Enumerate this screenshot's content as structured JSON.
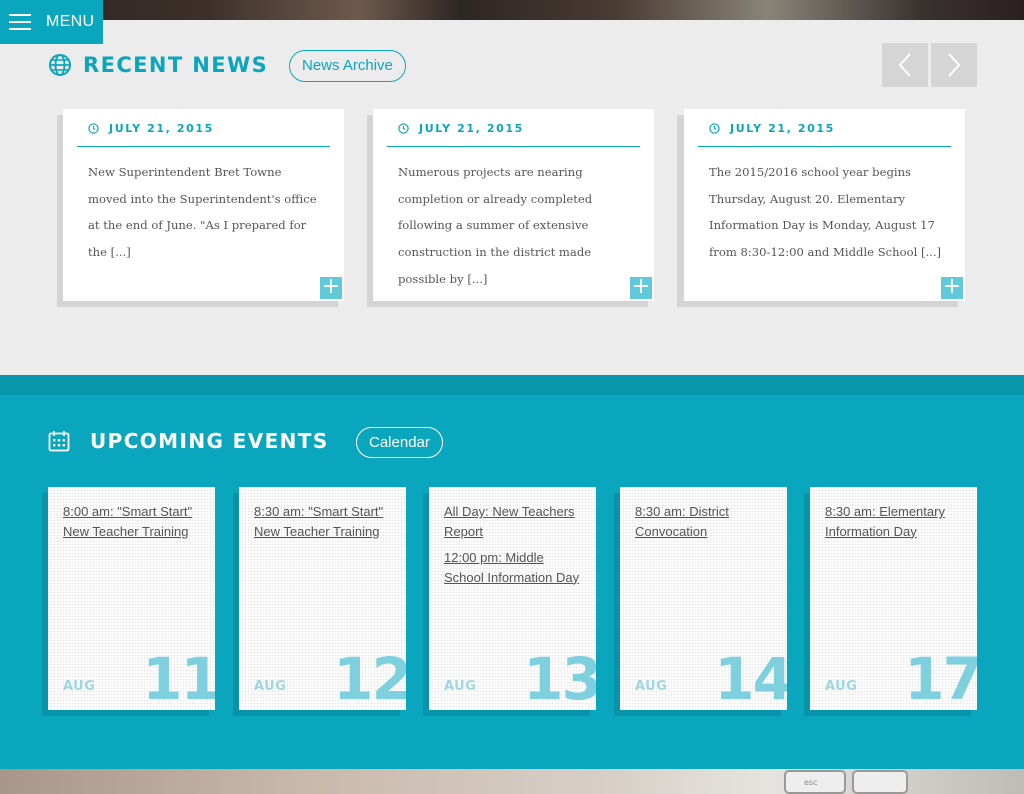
{
  "menu": {
    "label": "MENU"
  },
  "news": {
    "title": "RECENT NEWS",
    "archive_label": "News Archive",
    "cards": [
      {
        "date": "JULY 21, 2015",
        "text": "New Superintendent Bret Towne moved into the Superintendent's office at the end of June.  \"As I prepared for the [...]"
      },
      {
        "date": "JULY 21, 2015",
        "text": "Numerous projects are nearing completion or already completed following a summer of extensive construction in the district made possible by [...]"
      },
      {
        "date": "JULY 21, 2015",
        "text": "The 2015/2016 school year begins Thursday, August 20. Elementary Information Day is Monday, August 17 from 8:30-12:00 and Middle School [...]"
      }
    ],
    "plus_glyph": "+",
    "prev_icon": "chevron-left-icon",
    "next_icon": "chevron-right-icon"
  },
  "events": {
    "title": "UPCOMING EVENTS",
    "calendar_label": "Calendar",
    "cards": [
      {
        "month": "AUG",
        "day": "11",
        "items": [
          "8:00 am: \"Smart Start\" New Teacher Training"
        ]
      },
      {
        "month": "AUG",
        "day": "12",
        "items": [
          "8:30 am: \"Smart Start\" New Teacher Training"
        ]
      },
      {
        "month": "AUG",
        "day": "13",
        "items": [
          "All Day: New Teachers Report",
          "12:00 pm: Middle School Information Day"
        ]
      },
      {
        "month": "AUG",
        "day": "14",
        "items": [
          "8:30 am: District Convocation"
        ]
      },
      {
        "month": "AUG",
        "day": "17",
        "items": [
          "8:30 am: Elementary Information Day"
        ]
      }
    ]
  },
  "keyboard": {
    "esc_label": "esc"
  },
  "colors": {
    "accent": "#0aa6bd",
    "accent_light": "#7fd0de",
    "background": "#ececec"
  }
}
